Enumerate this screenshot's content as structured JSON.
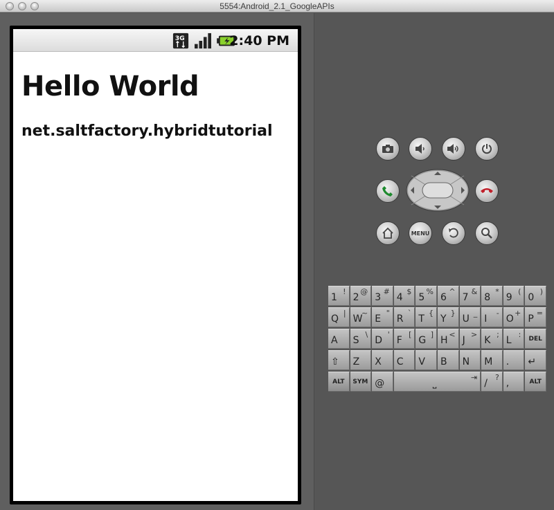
{
  "window": {
    "title": "5554:Android_2.1_GoogleAPIs"
  },
  "statusbar": {
    "network": "3G",
    "time": "2:40 PM"
  },
  "app": {
    "title": "Hello World",
    "package": "net.saltfactory.hybridtutorial"
  },
  "controls": {
    "menu_label": "MENU",
    "icons": [
      "camera-icon",
      "volume-down-icon",
      "volume-up-icon",
      "power-icon",
      "call-icon",
      "end-call-icon",
      "home-icon",
      "menu-icon",
      "back-icon",
      "search-icon"
    ]
  },
  "keyboard": {
    "row1": [
      {
        "main": "1",
        "alt": "!"
      },
      {
        "main": "2",
        "alt": "@"
      },
      {
        "main": "3",
        "alt": "#"
      },
      {
        "main": "4",
        "alt": "$"
      },
      {
        "main": "5",
        "alt": "%"
      },
      {
        "main": "6",
        "alt": "^"
      },
      {
        "main": "7",
        "alt": "&"
      },
      {
        "main": "8",
        "alt": "*"
      },
      {
        "main": "9",
        "alt": "("
      },
      {
        "main": "0",
        "alt": ")"
      }
    ],
    "row2": [
      {
        "main": "Q",
        "alt": "|"
      },
      {
        "main": "W",
        "alt": "~"
      },
      {
        "main": "E",
        "alt": "\""
      },
      {
        "main": "R",
        "alt": "`"
      },
      {
        "main": "T",
        "alt": "{"
      },
      {
        "main": "Y",
        "alt": "}"
      },
      {
        "main": "U",
        "alt": "_"
      },
      {
        "main": "I",
        "alt": "-"
      },
      {
        "main": "O",
        "alt": "+"
      },
      {
        "main": "P",
        "alt": "="
      }
    ],
    "row3": [
      {
        "main": "A",
        "alt": ""
      },
      {
        "main": "S",
        "alt": "\\"
      },
      {
        "main": "D",
        "alt": "'"
      },
      {
        "main": "F",
        "alt": "["
      },
      {
        "main": "G",
        "alt": "]"
      },
      {
        "main": "H",
        "alt": "<"
      },
      {
        "main": "J",
        "alt": ">"
      },
      {
        "main": "K",
        "alt": ";"
      },
      {
        "main": "L",
        "alt": ":"
      },
      {
        "main": "DEL",
        "alt": ""
      }
    ],
    "row4": [
      {
        "main": "⇧",
        "alt": ""
      },
      {
        "main": "Z",
        "alt": ""
      },
      {
        "main": "X",
        "alt": ""
      },
      {
        "main": "C",
        "alt": ""
      },
      {
        "main": "V",
        "alt": ""
      },
      {
        "main": "B",
        "alt": ""
      },
      {
        "main": "N",
        "alt": ""
      },
      {
        "main": "M",
        "alt": ""
      },
      {
        "main": ".",
        "alt": ""
      },
      {
        "main": "↵",
        "alt": ""
      }
    ],
    "row5": [
      {
        "main": "ALT",
        "alt": ""
      },
      {
        "main": "SYM",
        "alt": ""
      },
      {
        "main": "@",
        "alt": ""
      },
      {
        "main": "⎵",
        "alt": "⇥"
      },
      {
        "main": "/",
        "alt": "?"
      },
      {
        "main": ",",
        "alt": ""
      },
      {
        "main": "ALT",
        "alt": ""
      }
    ]
  }
}
